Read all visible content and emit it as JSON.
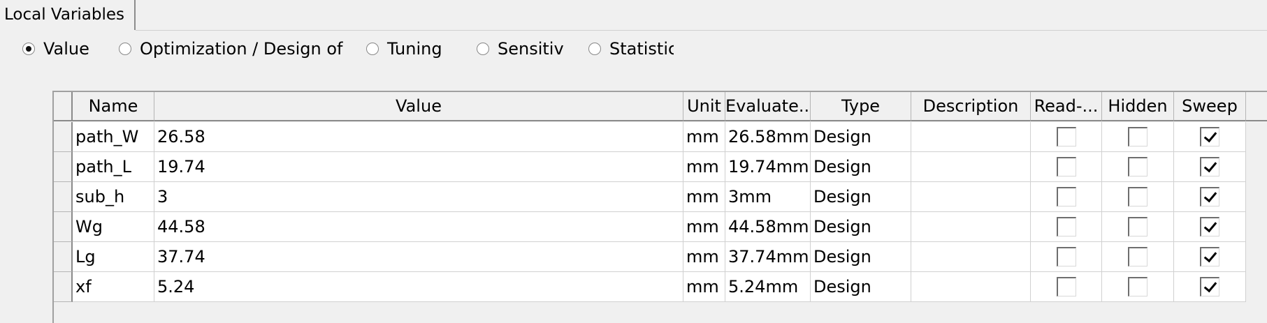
{
  "tab": {
    "label": "Local Variables"
  },
  "radio_options": [
    {
      "label": "Value",
      "checked": true
    },
    {
      "label": "Optimization / Design of",
      "checked": false
    },
    {
      "label": "Tuning",
      "checked": false
    },
    {
      "label": "Sensitiv",
      "checked": false
    },
    {
      "label": "Statistic",
      "checked": false
    }
  ],
  "table": {
    "columns": [
      "Name",
      "Value",
      "Unit",
      "Evaluate...",
      "Type",
      "Description",
      "Read-...",
      "Hidden",
      "Sweep"
    ],
    "rows": [
      {
        "name": "path_W",
        "value": "26.58",
        "unit": "mm",
        "evaluated": "26.58mm",
        "type": "Design",
        "description": "",
        "read_only": false,
        "hidden": false,
        "sweep": true
      },
      {
        "name": "path_L",
        "value": "19.74",
        "unit": "mm",
        "evaluated": "19.74mm",
        "type": "Design",
        "description": "",
        "read_only": false,
        "hidden": false,
        "sweep": true
      },
      {
        "name": "sub_h",
        "value": "3",
        "unit": "mm",
        "evaluated": "3mm",
        "type": "Design",
        "description": "",
        "read_only": false,
        "hidden": false,
        "sweep": true
      },
      {
        "name": "Wg",
        "value": "44.58",
        "unit": "mm",
        "evaluated": "44.58mm",
        "type": "Design",
        "description": "",
        "read_only": false,
        "hidden": false,
        "sweep": true
      },
      {
        "name": "Lg",
        "value": "37.74",
        "unit": "mm",
        "evaluated": "37.74mm",
        "type": "Design",
        "description": "",
        "read_only": false,
        "hidden": false,
        "sweep": true
      },
      {
        "name": "xf",
        "value": "5.24",
        "unit": "mm",
        "evaluated": "5.24mm",
        "type": "Design",
        "description": "",
        "read_only": false,
        "hidden": false,
        "sweep": true
      }
    ]
  }
}
